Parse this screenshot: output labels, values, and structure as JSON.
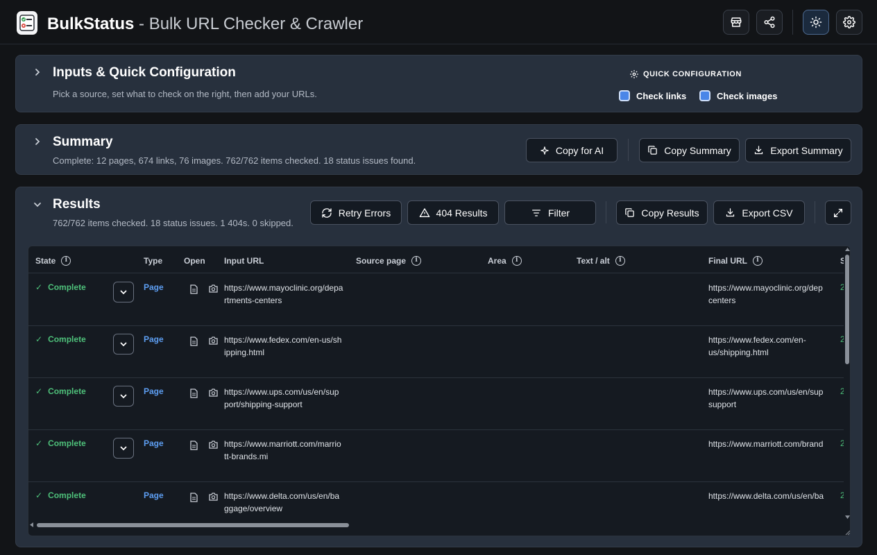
{
  "app": {
    "name": "BulkStatus",
    "subtitle": " - Bulk URL Checker & Crawler"
  },
  "header_icons": [
    "store-icon",
    "share-icon",
    "sun-icon",
    "gear-icon"
  ],
  "inputs": {
    "title": "Inputs & Quick Configuration",
    "subtitle": "Pick a source, set what to check on the right, then add your URLs.",
    "quick_config_label": "QUICK CONFIGURATION",
    "check_links_label": "Check links",
    "check_links": true,
    "check_images_label": "Check images",
    "check_images": true
  },
  "summary": {
    "title": "Summary",
    "subtitle": "Complete: 12 pages, 674 links, 76 images. 762/762 items checked. 18 status issues found.",
    "copy_ai_label": "Copy for AI",
    "copy_summary_label": "Copy Summary",
    "export_summary_label": "Export Summary"
  },
  "results": {
    "title": "Results",
    "subtitle": "762/762 items checked. 18 status issues. 1 404s. 0 skipped.",
    "retry_label": "Retry Errors",
    "results_404_label": "404 Results",
    "filter_label": "Filter",
    "copy_results_label": "Copy Results",
    "export_csv_label": "Export CSV",
    "columns": [
      "State",
      "Type",
      "Open",
      "Input URL",
      "Source page",
      "Area",
      "Text / alt",
      "Final URL",
      "S"
    ],
    "rows": [
      {
        "state": "Complete",
        "type": "Page",
        "input_url": "https://www.mayoclinic.org/departments-centers",
        "final_url_l1": "https://www.mayoclinic.org/dep",
        "final_url_l2": "centers",
        "status": "2",
        "expand": true
      },
      {
        "state": "Complete",
        "type": "Page",
        "input_url": "https://www.fedex.com/en-us/shipping.html",
        "final_url_l1": "https://www.fedex.com/en-",
        "final_url_l2": "us/shipping.html",
        "status": "2",
        "expand": true
      },
      {
        "state": "Complete",
        "type": "Page",
        "input_url": "https://www.ups.com/us/en/support/shipping-support",
        "final_url_l1": "https://www.ups.com/us/en/sup",
        "final_url_l2": "support",
        "status": "2",
        "expand": true
      },
      {
        "state": "Complete",
        "type": "Page",
        "input_url": "https://www.marriott.com/marriott-brands.mi",
        "final_url_l1": "https://www.marriott.com/brand",
        "final_url_l2": "",
        "status": "2",
        "expand": true
      },
      {
        "state": "Complete",
        "type": "Page",
        "input_url": "https://www.delta.com/us/en/baggage/overview",
        "final_url_l1": "https://www.delta.com/us/en/ba",
        "final_url_l2": "",
        "status": "2",
        "expand": false
      }
    ]
  },
  "colors": {
    "background": "#121417",
    "panel": "#27303d",
    "complete": "#4ec07a",
    "link": "#5d9ef2",
    "checkbox": "#4a86e8"
  }
}
